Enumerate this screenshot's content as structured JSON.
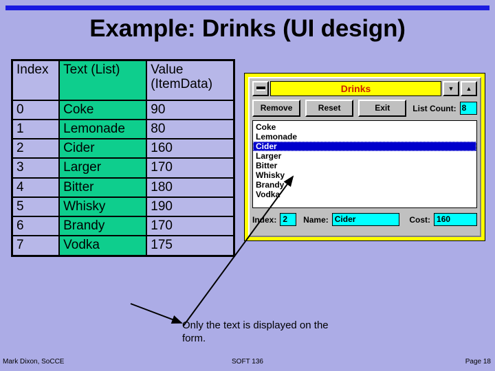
{
  "slide": {
    "title": "Example: Drinks (UI design)"
  },
  "table": {
    "headers": [
      "Index",
      "Text (List)",
      "Value (ItemData)"
    ],
    "header_index": "Index",
    "header_text": "Text (List)",
    "header_value_line1": "Value",
    "header_value_line2": "(ItemData)",
    "rows": [
      {
        "index": "0",
        "text": "Coke",
        "value": "90"
      },
      {
        "index": "1",
        "text": "Lemonade",
        "value": "80"
      },
      {
        "index": "2",
        "text": "Cider",
        "value": "160"
      },
      {
        "index": "3",
        "text": "Larger",
        "value": "170"
      },
      {
        "index": "4",
        "text": "Bitter",
        "value": "180"
      },
      {
        "index": "5",
        "text": "Whisky",
        "value": "190"
      },
      {
        "index": "6",
        "text": "Brandy",
        "value": "170"
      },
      {
        "index": "7",
        "text": "Vodka",
        "value": "175"
      }
    ]
  },
  "dialog": {
    "title": "Drinks",
    "sysmenu_icon": "minimize-bar-icon",
    "minimize_icon": "chevron-down-icon",
    "maximize_icon": "chevron-up-icon",
    "buttons": [
      {
        "label": "Remove",
        "name": "remove-button"
      },
      {
        "label": "Reset",
        "name": "reset-button"
      },
      {
        "label": "Exit",
        "name": "exit-button"
      }
    ],
    "list_count_label": "List Count:",
    "list_count_value": "8",
    "listbox": {
      "items": [
        "Coke",
        "Lemonade",
        "Cider",
        "Larger",
        "Bitter",
        "Whisky",
        "Brandy",
        "Vodka"
      ],
      "selected_index": 2,
      "selected_value": "Cider"
    },
    "fields": {
      "index_label": "Index:",
      "index_value": "2",
      "name_label": "Name:",
      "name_value": "Cider",
      "cost_label": "Cost:",
      "cost_value": "160"
    }
  },
  "annotation": {
    "caption_line1": "Only the text is displayed on",
    "caption_line2": "the form."
  },
  "footer": {
    "left": "Mark Dixon, SoCCE",
    "center": "SOFT 136",
    "right": "Page 18"
  },
  "colors": {
    "slide_background": "#acace6",
    "rule_blue": "#1a1ae0",
    "table_green": "#0ece8d",
    "table_cell": "#b7b7e8",
    "dialog_frame_yellow": "#ffff00",
    "dialog_face": "#c0c0c0",
    "titlebar_text": "#cc2200",
    "field_cyan": "#00ffff",
    "selection_blue": "#0000cc"
  }
}
